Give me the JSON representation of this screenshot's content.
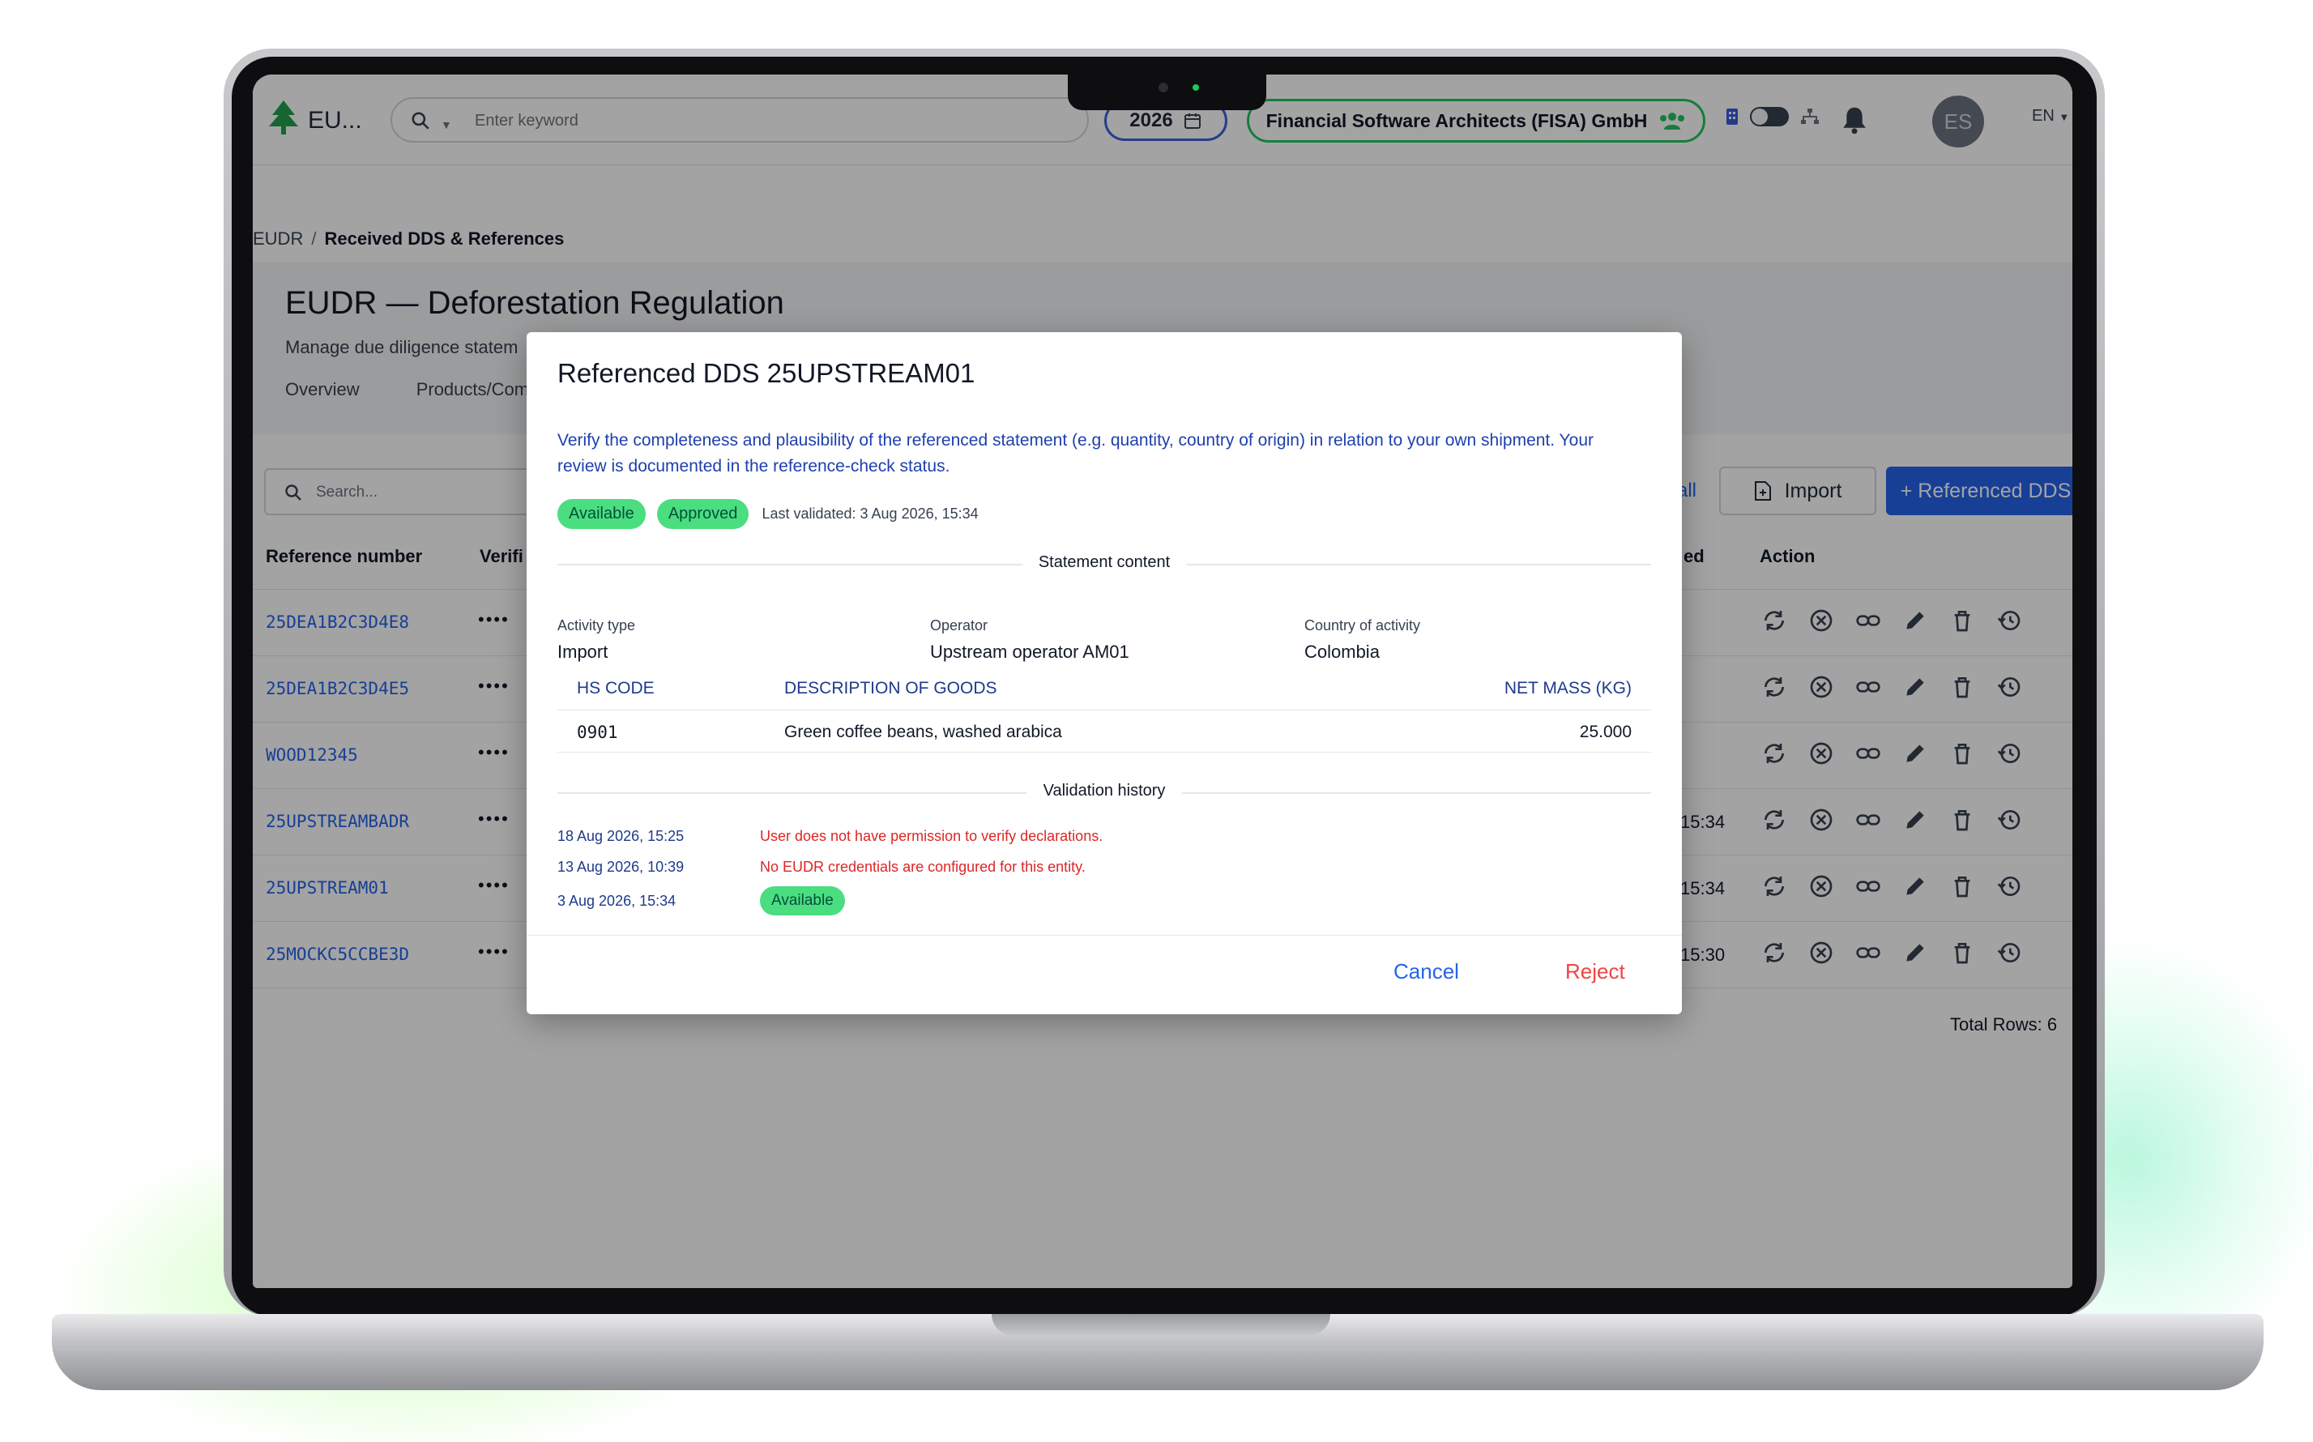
{
  "app": {
    "title": "EU...",
    "search_placeholder": "Enter keyword",
    "year": "2026",
    "organization": "Financial Software Architects (FISA) GmbH",
    "avatar_initials": "ES",
    "language": "EN"
  },
  "breadcrumb": {
    "root": "EUDR",
    "separator": "/",
    "current": "Received DDS & References"
  },
  "page": {
    "title": "EUDR — Deforestation Regulation",
    "subtitle": "Manage due diligence statem",
    "tabs": [
      {
        "label": "Overview"
      },
      {
        "label": "Products/Com"
      }
    ]
  },
  "toolbar": {
    "search_placeholder": "Search...",
    "all_label": "all",
    "import_label": "Import",
    "add_label": "+ Referenced DDS"
  },
  "table": {
    "headers": {
      "reference": "Reference number",
      "verification": "Verifi",
      "validated": "ed",
      "action": "Action"
    },
    "rows": [
      {
        "ref": "25DEA1B2C3D4E8",
        "masked": "••••",
        "time": ""
      },
      {
        "ref": "25DEA1B2C3D4E5",
        "masked": "••••",
        "time": ""
      },
      {
        "ref": "WOOD12345",
        "masked": "••••",
        "time": ""
      },
      {
        "ref": "25UPSTREAMBADR",
        "masked": "••••",
        "time": "15:34"
      },
      {
        "ref": "25UPSTREAM01",
        "masked": "••••",
        "time": "15:34"
      },
      {
        "ref": "25MOCKC5CCBE3D",
        "masked": "••••",
        "time": "15:30"
      }
    ],
    "total": "Total Rows: 6"
  },
  "modal": {
    "title": "Referenced DDS 25UPSTREAM01",
    "description": "Verify the completeness and plausibility of the referenced statement (e.g. quantity, country of origin) in relation to your own shipment. Your review is documented in the reference-check status.",
    "badges": [
      {
        "label": "Available"
      },
      {
        "label": "Approved"
      }
    ],
    "last_validated": "Last validated: 3 Aug 2026, 15:34",
    "content_section": "Statement content",
    "fields": {
      "activity_label": "Activity type",
      "activity_value": "Import",
      "operator_label": "Operator",
      "operator_value": "Upstream operator AM01",
      "country_label": "Country of activity",
      "country_value": "Colombia"
    },
    "goods": {
      "headers": {
        "hs": "HS CODE",
        "desc": "DESCRIPTION OF GOODS",
        "mass": "NET MASS (KG)"
      },
      "rows": [
        {
          "hs": "0901",
          "desc": "Green coffee beans, washed arabica",
          "mass": "25.000"
        }
      ]
    },
    "history_section": "Validation history",
    "history": [
      {
        "date": "18 Aug 2026, 15:25",
        "message": "User does not have permission to verify declarations."
      },
      {
        "date": "13 Aug 2026, 10:39",
        "message": "No EUDR credentials are configured for this entity."
      },
      {
        "date": "3 Aug 2026, 15:34",
        "badge": "Available"
      }
    ],
    "cancel_label": "Cancel",
    "reject_label": "Reject"
  },
  "colors": {
    "primary": "#2563eb",
    "success": "#4ade80",
    "danger": "#ef4444",
    "brand_green": "#22c55e"
  }
}
